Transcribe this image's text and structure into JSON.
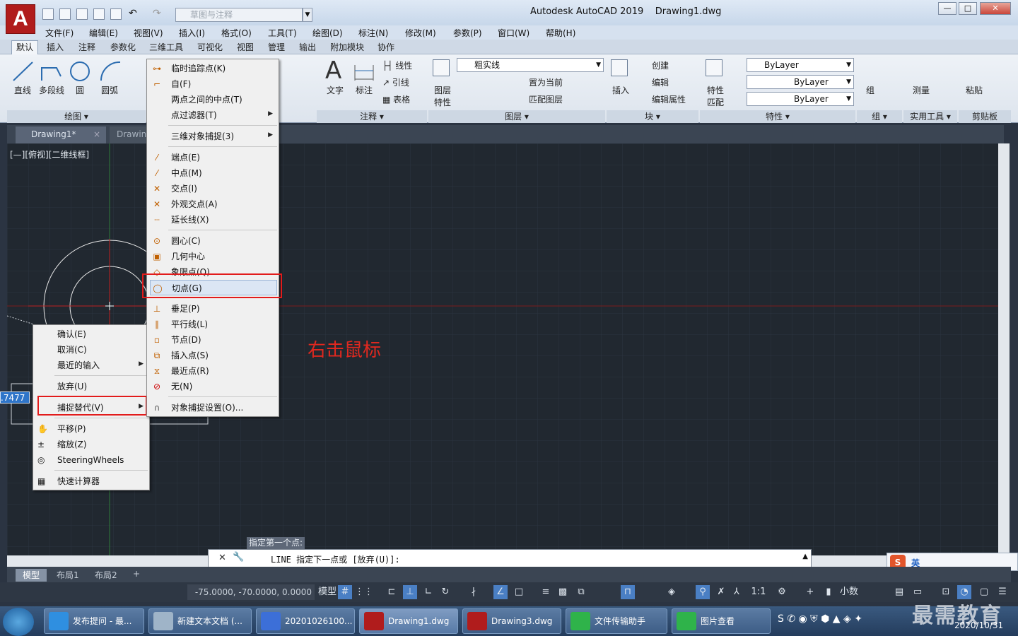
{
  "app": {
    "title": "Autodesk AutoCAD 2019",
    "document": "Drawing1.dwg",
    "workspace_placeholder": "草图与注释",
    "logo": "A"
  },
  "window_controls": [
    "—",
    "□",
    "✕"
  ],
  "menu": [
    "文件(F)",
    "编辑(E)",
    "视图(V)",
    "插入(I)",
    "格式(O)",
    "工具(T)",
    "绘图(D)",
    "标注(N)",
    "修改(M)",
    "参数(P)",
    "窗口(W)",
    "帮助(H)"
  ],
  "ribbon_tabs": [
    "默认",
    "插入",
    "注释",
    "参数化",
    "三维工具",
    "可视化",
    "视图",
    "管理",
    "输出",
    "附加模块",
    "协作"
  ],
  "ribbon": {
    "draw": {
      "line": "直线",
      "polyline": "多段线",
      "circle": "圆",
      "arc": "圆弧",
      "title": "绘图 ▾"
    },
    "annotation": {
      "text": "文字",
      "dim": "标注",
      "linear": "线性",
      "leader": "引线",
      "table": "表格",
      "title": "注释 ▾"
    },
    "layers": {
      "props1": "图层",
      "props2": "特性",
      "layer_name": "粗实线",
      "make_current": "置为当前",
      "match": "匹配图层",
      "title": "图层 ▾"
    },
    "block": {
      "insert": "插入",
      "create": "创建",
      "edit": "编辑",
      "edit_attr": "编辑属性",
      "title": "块 ▾"
    },
    "properties": {
      "match1": "特性",
      "match2": "匹配",
      "color": "ByLayer",
      "linetype": "ByLayer",
      "lineweight": "ByLayer",
      "title": "特性 ▾"
    },
    "groups": {
      "group": "组",
      "title": "组 ▾"
    },
    "utilities": {
      "measure": "测量",
      "title": "实用工具 ▾"
    },
    "clipboard": {
      "paste": "粘贴",
      "title": "剪贴板"
    }
  },
  "doc_tabs": {
    "tab1": "Drawing1*",
    "tab2": "Drawin"
  },
  "viewport_label": "[—][俯视][二维线框]",
  "context_menu_left": {
    "items": [
      "确认(E)",
      "取消(C)",
      "最近的输入",
      "放弃(U)",
      "捕捉替代(V)",
      "平移(P)",
      "缩放(Z)",
      "SteeringWheels",
      "快速计算器"
    ]
  },
  "context_menu_snap": {
    "items": [
      "临时追踪点(K)",
      "自(F)",
      "两点之间的中点(T)",
      "点过滤器(T)",
      "三维对象捕捉(3)",
      "端点(E)",
      "中点(M)",
      "交点(I)",
      "外观交点(A)",
      "延长线(X)",
      "圆心(C)",
      "几何中心",
      "象限点(Q)",
      "切点(G)",
      "垂足(P)",
      "平行线(L)",
      "节点(D)",
      "插入点(S)",
      "最近点(R)",
      "无(N)",
      "对象捕捉设置(O)..."
    ]
  },
  "annotation_text": "右击鼠标",
  "input_value": ".7477",
  "command": {
    "prompt": "指定第一个点:",
    "line": "LINE 指定下一点或 [放弃(U)]:"
  },
  "layout_tabs": [
    "模型",
    "布局1",
    "布局2",
    "+"
  ],
  "status": {
    "coords": "-75.0000, -70.0000, 0.0000",
    "model": "模型",
    "scale": "1:1",
    "units": "小数"
  },
  "ime": {
    "lang": "英"
  },
  "taskbar": {
    "items": [
      "发布提问 - 最...",
      "新建文本文档 (...",
      "20201026100...",
      "Drawing1.dwg",
      "Drawing3.dwg",
      "文件传输助手",
      "图片查看"
    ],
    "time": "2020/10/31"
  },
  "watermark": "最需教育",
  "colors": {
    "accent_red": "#e21b1b",
    "canvas": "#212830",
    "title_blue": "#c7d7ea"
  }
}
